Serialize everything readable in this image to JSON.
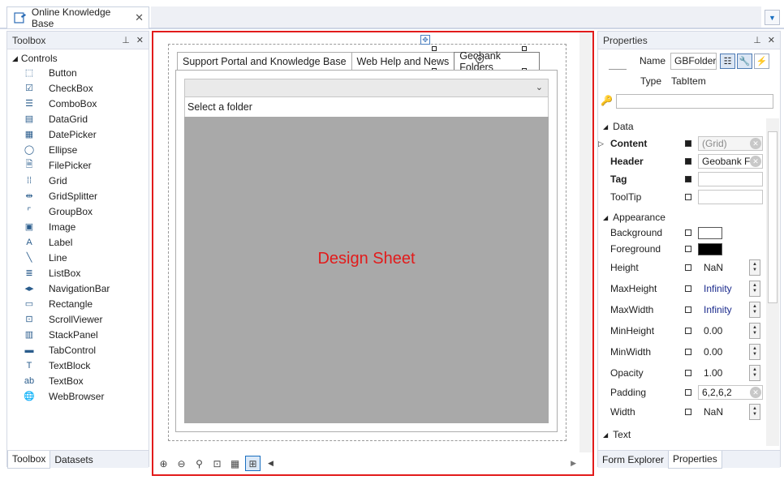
{
  "document": {
    "tab_title": "Online Knowledge Base"
  },
  "toolbox": {
    "title": "Toolbox",
    "category": "Controls",
    "items": [
      {
        "label": "Button",
        "icon": "button-icon"
      },
      {
        "label": "CheckBox",
        "icon": "checkbox-icon"
      },
      {
        "label": "ComboBox",
        "icon": "combobox-icon"
      },
      {
        "label": "DataGrid",
        "icon": "datagrid-icon"
      },
      {
        "label": "DatePicker",
        "icon": "datepicker-icon"
      },
      {
        "label": "Ellipse",
        "icon": "ellipse-icon"
      },
      {
        "label": "FilePicker",
        "icon": "filepicker-icon"
      },
      {
        "label": "Grid",
        "icon": "grid-icon"
      },
      {
        "label": "GridSplitter",
        "icon": "gridsplitter-icon"
      },
      {
        "label": "GroupBox",
        "icon": "groupbox-icon"
      },
      {
        "label": "Image",
        "icon": "image-icon"
      },
      {
        "label": "Label",
        "icon": "label-icon"
      },
      {
        "label": "Line",
        "icon": "line-icon"
      },
      {
        "label": "ListBox",
        "icon": "listbox-icon"
      },
      {
        "label": "NavigationBar",
        "icon": "navigationbar-icon"
      },
      {
        "label": "Rectangle",
        "icon": "rectangle-icon"
      },
      {
        "label": "ScrollViewer",
        "icon": "scrollviewer-icon"
      },
      {
        "label": "StackPanel",
        "icon": "stackpanel-icon"
      },
      {
        "label": "TabControl",
        "icon": "tabcontrol-icon"
      },
      {
        "label": "TextBlock",
        "icon": "textblock-icon"
      },
      {
        "label": "TextBox",
        "icon": "textbox-icon"
      },
      {
        "label": "WebBrowser",
        "icon": "webbrowser-icon"
      }
    ],
    "bottom_tabs": [
      "Toolbox",
      "Datasets"
    ]
  },
  "designer": {
    "tabs": [
      "Support Portal and Knowledge Base",
      "Web Help and News",
      "Geobank Folders"
    ],
    "selected_tab": "Geobank Folders",
    "folder_label": "Select a folder",
    "sheet_label": "Design Sheet"
  },
  "properties": {
    "title": "Properties",
    "name_label": "Name",
    "name_value": "GBFolder",
    "type_label": "Type",
    "type_value": "TabItem",
    "search_placeholder": "",
    "categories": {
      "data": "Data",
      "appearance": "Appearance",
      "text": "Text"
    },
    "data_props": [
      {
        "name": "Content",
        "value": "(Grid)"
      },
      {
        "name": "Header",
        "value": "Geobank F"
      },
      {
        "name": "Tag",
        "value": ""
      },
      {
        "name": "ToolTip",
        "value": ""
      }
    ],
    "appearance_props": [
      {
        "name": "Background",
        "color": "#ffffff"
      },
      {
        "name": "Foreground",
        "color": "#000000"
      },
      {
        "name": "Height",
        "value": "NaN"
      },
      {
        "name": "MaxHeight",
        "value": "Infinity"
      },
      {
        "name": "MaxWidth",
        "value": "Infinity"
      },
      {
        "name": "MinHeight",
        "value": "0.00"
      },
      {
        "name": "MinWidth",
        "value": "0.00"
      },
      {
        "name": "Opacity",
        "value": "1.00"
      },
      {
        "name": "Padding",
        "value": "6,2,6,2"
      },
      {
        "name": "Width",
        "value": "NaN"
      }
    ],
    "bottom_tabs": [
      "Form Explorer",
      "Properties"
    ]
  }
}
